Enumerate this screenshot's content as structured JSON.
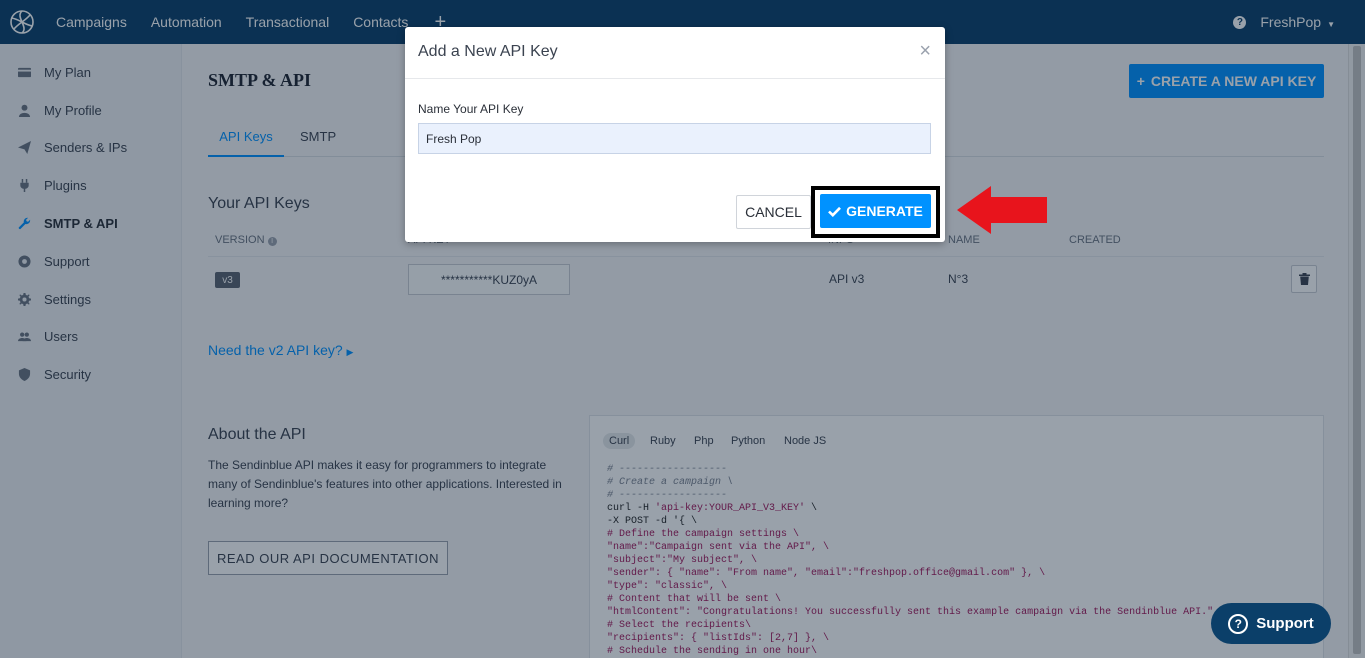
{
  "nav": {
    "items": [
      "Campaigns",
      "Automation",
      "Transactional",
      "Contacts"
    ],
    "plus": "+",
    "help_icon": "?",
    "account": "FreshPop"
  },
  "sidebar": {
    "items": [
      {
        "label": "My Plan",
        "icon": "credit-card-icon"
      },
      {
        "label": "My Profile",
        "icon": "user-icon"
      },
      {
        "label": "Senders & IPs",
        "icon": "paper-plane-icon"
      },
      {
        "label": "Plugins",
        "icon": "plug-icon"
      },
      {
        "label": "SMTP & API",
        "icon": "wrench-icon",
        "active": true
      },
      {
        "label": "Support",
        "icon": "lifebuoy-icon"
      },
      {
        "label": "Settings",
        "icon": "gear-icon"
      },
      {
        "label": "Users",
        "icon": "users-icon"
      },
      {
        "label": "Security",
        "icon": "shield-icon"
      }
    ]
  },
  "page": {
    "title": "SMTP & API",
    "create_button": "CREATE A NEW API KEY",
    "create_plus": "+",
    "tabs": [
      "API Keys",
      "SMTP"
    ],
    "keys_heading": "Your API Keys",
    "table": {
      "headers": [
        "VERSION",
        "API KEY",
        "INFO",
        "NAME",
        "CREATED"
      ],
      "row": {
        "version": "v3",
        "key": "***********KUZ0yA",
        "info": "API v3",
        "name": "N°3",
        "created": ""
      }
    },
    "v2_link": "Need the v2 API key?",
    "about_heading": "About the API",
    "about_text": "The Sendinblue API makes it easy for programmers to integrate many of Sendinblue's features into other applications. Interested in learning more?",
    "doc_button": "READ OUR API DOCUMENTATION",
    "code_langs": [
      "Curl",
      "Ruby",
      "Php",
      "Python",
      "Node JS"
    ]
  },
  "code_lines": [
    {
      "t": "# ------------------",
      "c": "com"
    },
    {
      "t": "# Create a campaign \\",
      "c": "com"
    },
    {
      "t": "# ------------------",
      "c": "com"
    },
    {
      "t": "curl -H 'api-key:YOUR_API_V3_KEY' \\",
      "c": "mix1"
    },
    {
      "t": "-X POST -d '{ \\",
      "c": "plain"
    },
    {
      "t": "# Define the campaign settings \\",
      "c": "str"
    },
    {
      "t": "\"name\":\"Campaign sent via the API\", \\",
      "c": "str"
    },
    {
      "t": "\"subject\":\"My subject\", \\",
      "c": "str"
    },
    {
      "t": "\"sender\": { \"name\": \"From name\", \"email\":\"freshpop.office@gmail.com\" }, \\",
      "c": "str"
    },
    {
      "t": "\"type\": \"classic\", \\",
      "c": "str"
    },
    {
      "t": "# Content that will be sent \\",
      "c": "str"
    },
    {
      "t": "\"htmlContent\": \"Congratulations! You successfully sent this example campaign via the Sendinblue API.\", \\",
      "c": "str"
    },
    {
      "t": "# Select the recipients\\",
      "c": "str"
    },
    {
      "t": "\"recipients\": { \"listIds\": [2,7] }, \\",
      "c": "str"
    },
    {
      "t": "# Schedule the sending in one hour\\",
      "c": "str"
    }
  ],
  "modal": {
    "title": "Add a New API Key",
    "close": "×",
    "field_label": "Name Your API Key",
    "field_value": "Fresh Pop",
    "cancel": "CANCEL",
    "generate": "GENERATE"
  },
  "support_widget": {
    "label": "Support",
    "icon": "?"
  },
  "colors": {
    "brand": "#0b3f69",
    "accent": "#0092ff",
    "arrow": "#e8141c",
    "highlight": "#000000"
  }
}
